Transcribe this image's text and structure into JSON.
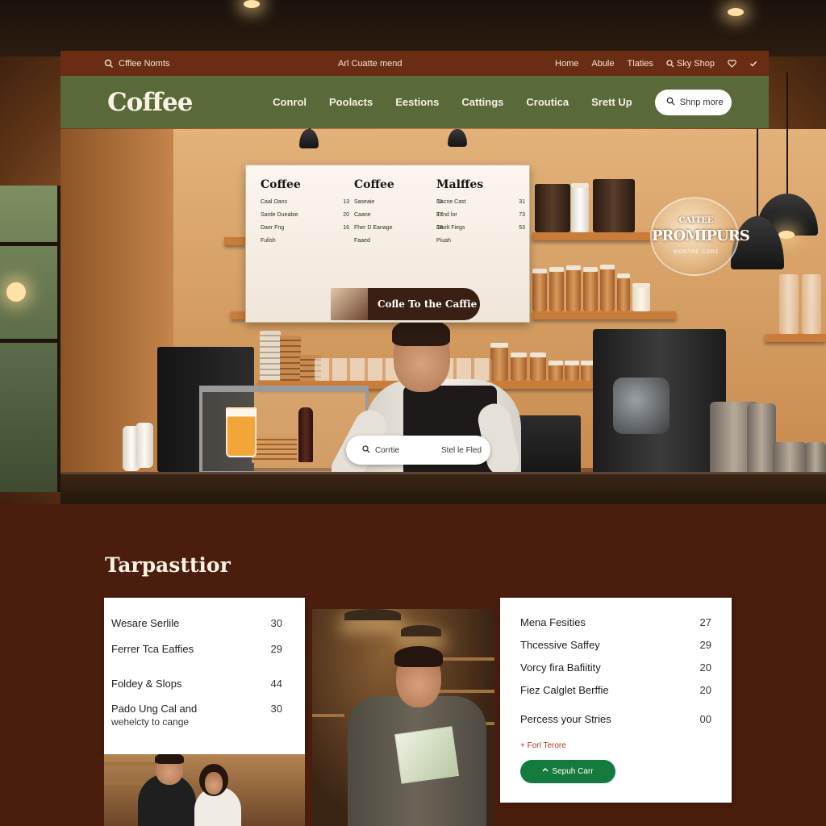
{
  "topbar": {
    "brand": "Cfflee Nomts",
    "tagline": "Arl Cuatte mend",
    "links": [
      "Home",
      "Abule",
      "Tlaties",
      "Sky Shop"
    ]
  },
  "navbar": {
    "logo": "Coffee",
    "links": [
      "Conrol",
      "Poolacts",
      "Eestions",
      "Cattings",
      "Croutica",
      "Srett Up"
    ],
    "shop_button": "Shnp more"
  },
  "menu_board": {
    "columns": [
      {
        "title": "Coffee",
        "rows": [
          {
            "name": "Caal Oans",
            "price": "13"
          },
          {
            "name": "Sarde Dueabie",
            "price": "20"
          },
          {
            "name": "Daer Fng",
            "price": "16"
          },
          {
            "name": "Fulish",
            "price": ""
          }
        ]
      },
      {
        "title": "Coffee",
        "rows": [
          {
            "name": "Saseaie",
            "price": "11"
          },
          {
            "name": "Caane",
            "price": "17"
          },
          {
            "name": "Fher D Eanage",
            "price": "18"
          },
          {
            "name": "Faaed",
            "price": ""
          }
        ]
      },
      {
        "title": "Malffes",
        "rows": [
          {
            "name": "Dacne Cast",
            "price": "31"
          },
          {
            "name": "Esnd lor",
            "price": "73"
          },
          {
            "name": "Daelt Fiegs",
            "price": "53"
          },
          {
            "name": "Piuah",
            "price": ""
          }
        ]
      }
    ],
    "banner": "Cofle To the Caffie"
  },
  "globe_sign": {
    "line1": "CAITEE",
    "line2": "PROMIPURS",
    "line3": "WONTRE CORE"
  },
  "photo_search": {
    "label_a": "Corrtie",
    "label_b": "Stel le Fled"
  },
  "section": {
    "title": "Tarpasttior"
  },
  "card_left": {
    "items": [
      {
        "label": "Wesare Serlile",
        "value": "30"
      },
      {
        "label": "Ferrer Tca Eaffies",
        "value": "29"
      },
      {
        "label": "Foldey & Slops",
        "value": "44"
      },
      {
        "label": "Pado Ung Cal and",
        "label2": "wehelcty to cange",
        "value": "30"
      }
    ]
  },
  "card_right": {
    "items": [
      {
        "label": "Mena Fesities",
        "value": "27"
      },
      {
        "label": "Thcessive Saffey",
        "value": "29"
      },
      {
        "label": "Vorcy fira Bafiitity",
        "value": "20"
      },
      {
        "label": "Fiez Calglet Berffie",
        "value": "20"
      },
      {
        "label": "Percess your Stries",
        "value": "00"
      }
    ],
    "link": "Forl Terore",
    "button": "Sepuh Carr"
  },
  "colors": {
    "topbar": "#6a2d14",
    "navbar": "#5a693a",
    "page": "#4a1d0c",
    "button_green": "#157a3d"
  },
  "icons": {
    "brand": "coffee-cup-icon",
    "search": "search-icon",
    "shop": "search-icon",
    "heart": "heart-icon",
    "check": "check-icon",
    "arrow": "arrow-up-icon"
  }
}
